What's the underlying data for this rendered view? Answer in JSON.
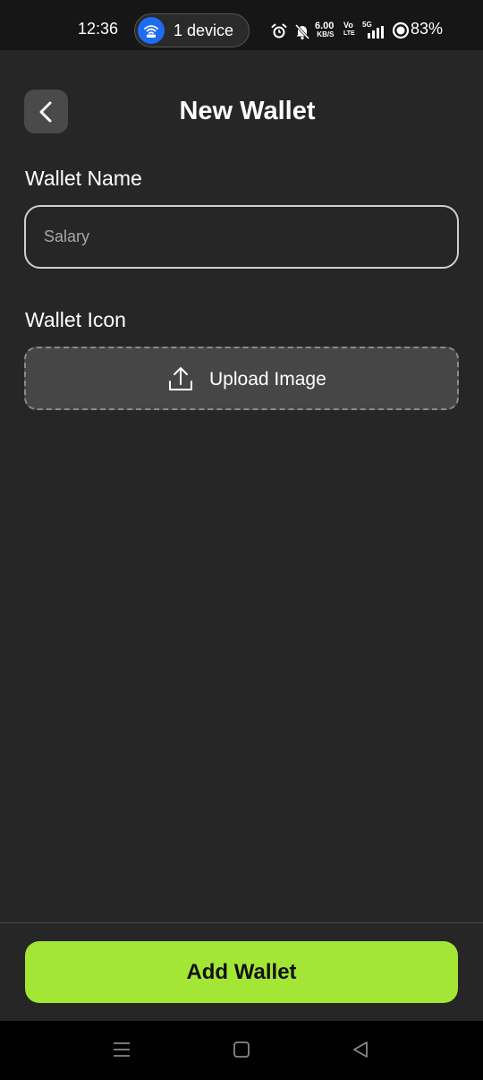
{
  "status_bar": {
    "time": "12:36",
    "hotspot_label": "1 device",
    "net_speed_value": "6.00",
    "net_speed_unit": "KB/S",
    "volte_top": "Vo",
    "volte_bottom": "LTE",
    "network_type": "5G",
    "battery": "83%",
    "icons": [
      "hotspot-icon",
      "alarm-icon",
      "mute-icon",
      "signal-icon",
      "battery-icon"
    ]
  },
  "header": {
    "title": "New Wallet",
    "back_icon": "chevron-left-icon"
  },
  "form": {
    "name_label": "Wallet Name",
    "name_value": "",
    "name_placeholder": "Salary",
    "icon_label": "Wallet Icon",
    "upload_label": "Upload Image",
    "upload_icon": "upload-icon"
  },
  "footer": {
    "submit_label": "Add Wallet"
  },
  "nav_bar": {
    "icons": [
      "menu-icon",
      "home-icon",
      "back-icon"
    ]
  },
  "colors": {
    "background": "#262626",
    "status_bar": "#161616",
    "accent": "#a3e635",
    "back_button_bg": "#4a4a4a",
    "upload_bg": "#464646",
    "hotspot_blue": "#1e6cf0"
  }
}
